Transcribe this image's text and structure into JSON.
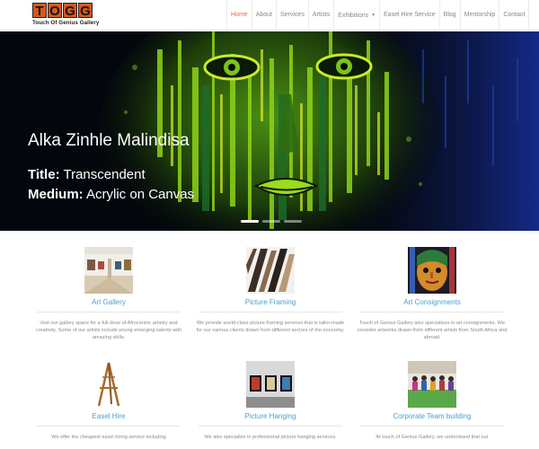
{
  "header": {
    "logo_letters": [
      "T",
      "O",
      "G",
      "G"
    ],
    "logo_tagline": "Touch Of Genius Gallery",
    "nav": [
      {
        "label": "Home",
        "active": true,
        "dropdown": false
      },
      {
        "label": "About",
        "active": false,
        "dropdown": false
      },
      {
        "label": "Services",
        "active": false,
        "dropdown": false
      },
      {
        "label": "Artists",
        "active": false,
        "dropdown": false
      },
      {
        "label": "Exhibitions",
        "active": false,
        "dropdown": true
      },
      {
        "label": "Easel Hire Service",
        "active": false,
        "dropdown": false
      },
      {
        "label": "Blog",
        "active": false,
        "dropdown": false
      },
      {
        "label": "Mentorship",
        "active": false,
        "dropdown": false
      },
      {
        "label": "Contact",
        "active": false,
        "dropdown": false
      }
    ],
    "dropdown_icon": "chevron-down-icon"
  },
  "hero": {
    "artist": "Alka Zinhle Malindisa",
    "title_label": "Title:",
    "title_value": "Transcendent",
    "medium_label": "Medium:",
    "medium_value": "Acrylic on Canvas",
    "slide_count": 3,
    "active_slide": 1
  },
  "services": [
    {
      "title": "Art Gallery",
      "description": "Visit our gallery space for a full dose of Afrocentric artistry and creativity. Some of our artists include young emerging talents with amazing skills."
    },
    {
      "title": "Picture Framing",
      "description": "We provide world-class picture framing services that is tailor-made for our various clients drawn from different sectors of the economy."
    },
    {
      "title": "Art Consignments",
      "description": "Touch of Genius Gallery also specializes in art consignments. We consider artworks drawn from different artists from South Africa and abroad."
    },
    {
      "title": "Easel Hire",
      "description": "We offer the cheapest easel hiring service including"
    },
    {
      "title": "Picture Hanging",
      "description": "We also specialize in professional picture hanging services."
    },
    {
      "title": "Corporate Team building",
      "description": "At touch of Genius Gallery, we understand that our"
    }
  ],
  "colors": {
    "accent": "#e8664f",
    "link": "#4a9fd0",
    "logo_orange": "#d8571c"
  }
}
